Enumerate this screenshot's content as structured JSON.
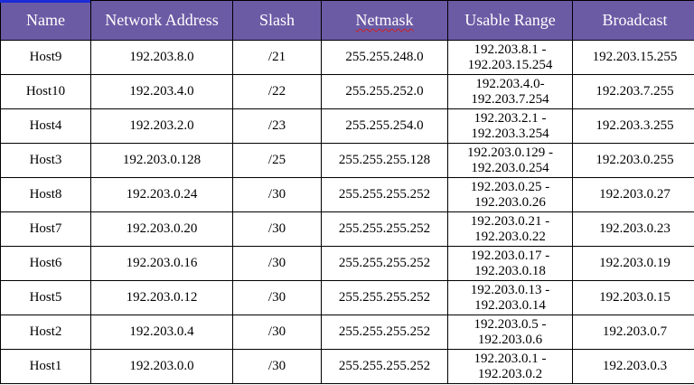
{
  "table": {
    "headers": [
      "Name",
      "Network Address",
      "Slash",
      "Netmask",
      "Usable Range",
      "Broadcast"
    ],
    "rows": [
      {
        "name": "Host9",
        "network": "192.203.8.0",
        "slash": "/21",
        "netmask": "255.255.248.0",
        "range_start": "192.203.8.1 -",
        "range_end": "192.203.15.254",
        "broadcast": "192.203.15.255"
      },
      {
        "name": "Host10",
        "network": "192.203.4.0",
        "slash": "/22",
        "netmask": "255.255.252.0",
        "range_start": "192.203.4.0-",
        "range_end": "192.203.7.254",
        "broadcast": "192.203.7.255"
      },
      {
        "name": "Host4",
        "network": "192.203.2.0",
        "slash": "/23",
        "netmask": "255.255.254.0",
        "range_start": "192.203.2.1 -",
        "range_end": "192.203.3.254",
        "broadcast": "192.203.3.255"
      },
      {
        "name": "Host3",
        "network": "192.203.0.128",
        "slash": "/25",
        "netmask": "255.255.255.128",
        "range_start": "192.203.0.129 -",
        "range_end": "192.203.0.254",
        "broadcast": "192.203.0.255"
      },
      {
        "name": "Host8",
        "network": "192.203.0.24",
        "slash": "/30",
        "netmask": "255.255.255.252",
        "range_start": "192.203.0.25 -",
        "range_end": "192.203.0.26",
        "broadcast": "192.203.0.27"
      },
      {
        "name": "Host7",
        "network": "192.203.0.20",
        "slash": "/30",
        "netmask": "255.255.255.252",
        "range_start": "192.203.0.21 -",
        "range_end": "192.203.0.22",
        "broadcast": "192.203.0.23"
      },
      {
        "name": "Host6",
        "network": "192.203.0.16",
        "slash": "/30",
        "netmask": "255.255.255.252",
        "range_start": "192.203.0.17 -",
        "range_end": "192.203.0.18",
        "broadcast": "192.203.0.19"
      },
      {
        "name": "Host5",
        "network": "192.203.0.12",
        "slash": "/30",
        "netmask": "255.255.255.252",
        "range_start": "192.203.0.13 -",
        "range_end": "192.203.0.14",
        "broadcast": "192.203.0.15"
      },
      {
        "name": "Host2",
        "network": "192.203.0.4",
        "slash": "/30",
        "netmask": "255.255.255.252",
        "range_start": "192.203.0.5 -",
        "range_end": "192.203.0.6",
        "broadcast": "192.203.0.7"
      },
      {
        "name": "Host1",
        "network": "192.203.0.0",
        "slash": "/30",
        "netmask": "255.255.255.252",
        "range_start": "192.203.0.1 -",
        "range_end": "192.203.0.2",
        "broadcast": "192.203.0.3"
      }
    ]
  },
  "colors": {
    "header_background": "#6b5ba5",
    "header_text": "#ffffff",
    "spellcheck_underline": "#d32020",
    "cursor_marker": "#1d2bd6"
  }
}
